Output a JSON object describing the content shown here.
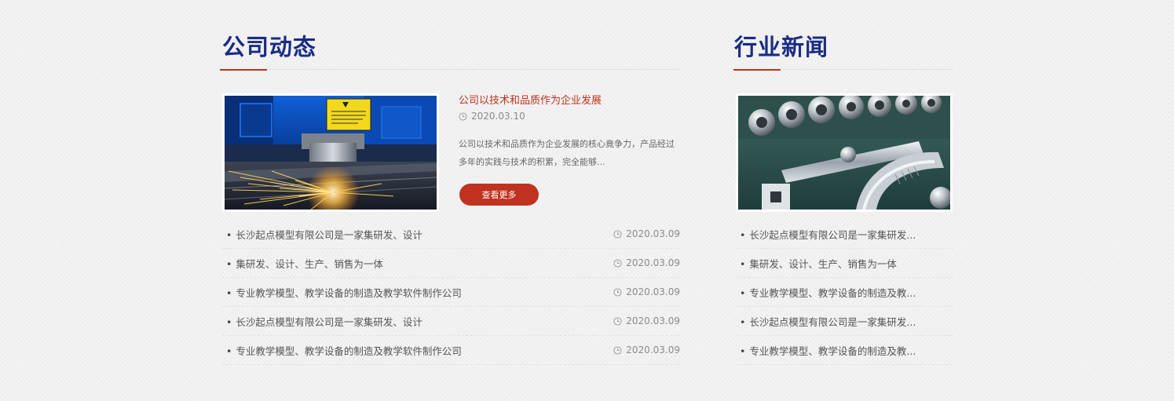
{
  "company": {
    "title": "公司动态",
    "feature": {
      "title": "公司以技术和品质作为企业发展",
      "date": "2020.03.10",
      "description": "公司以技术和品质作为企业发展的核心竟争力，产品经过多年的实践与技术的积累，完全能够...",
      "more_label": "查看更多",
      "image_icon": "laser-cutting-photo"
    },
    "items": [
      {
        "text": "长沙起点模型有限公司是一家集研发、设计",
        "date": "2020.03.09"
      },
      {
        "text": "集研发、设计、生产、销售为一体",
        "date": "2020.03.09"
      },
      {
        "text": "专业教学模型、教学设备的制造及教学软件制作公司",
        "date": "2020.03.09"
      },
      {
        "text": "长沙起点模型有限公司是一家集研发、设计",
        "date": "2020.03.09"
      },
      {
        "text": "专业教学模型、教学设备的制造及教学软件制作公司",
        "date": "2020.03.09"
      }
    ]
  },
  "industry": {
    "title": "行业新闻",
    "image_icon": "socket-wrench-set-photo",
    "items": [
      {
        "text": "长沙起点模型有限公司是一家集研发..."
      },
      {
        "text": "集研发、设计、生产、销售为一体"
      },
      {
        "text": "专业教学模型、教学设备的制造及教..."
      },
      {
        "text": "长沙起点模型有限公司是一家集研发..."
      },
      {
        "text": "专业教学模型、教学设备的制造及教..."
      }
    ]
  },
  "colors": {
    "title": "#1a2c84",
    "accent": "#c0321f",
    "date": "#8a8a8a"
  }
}
